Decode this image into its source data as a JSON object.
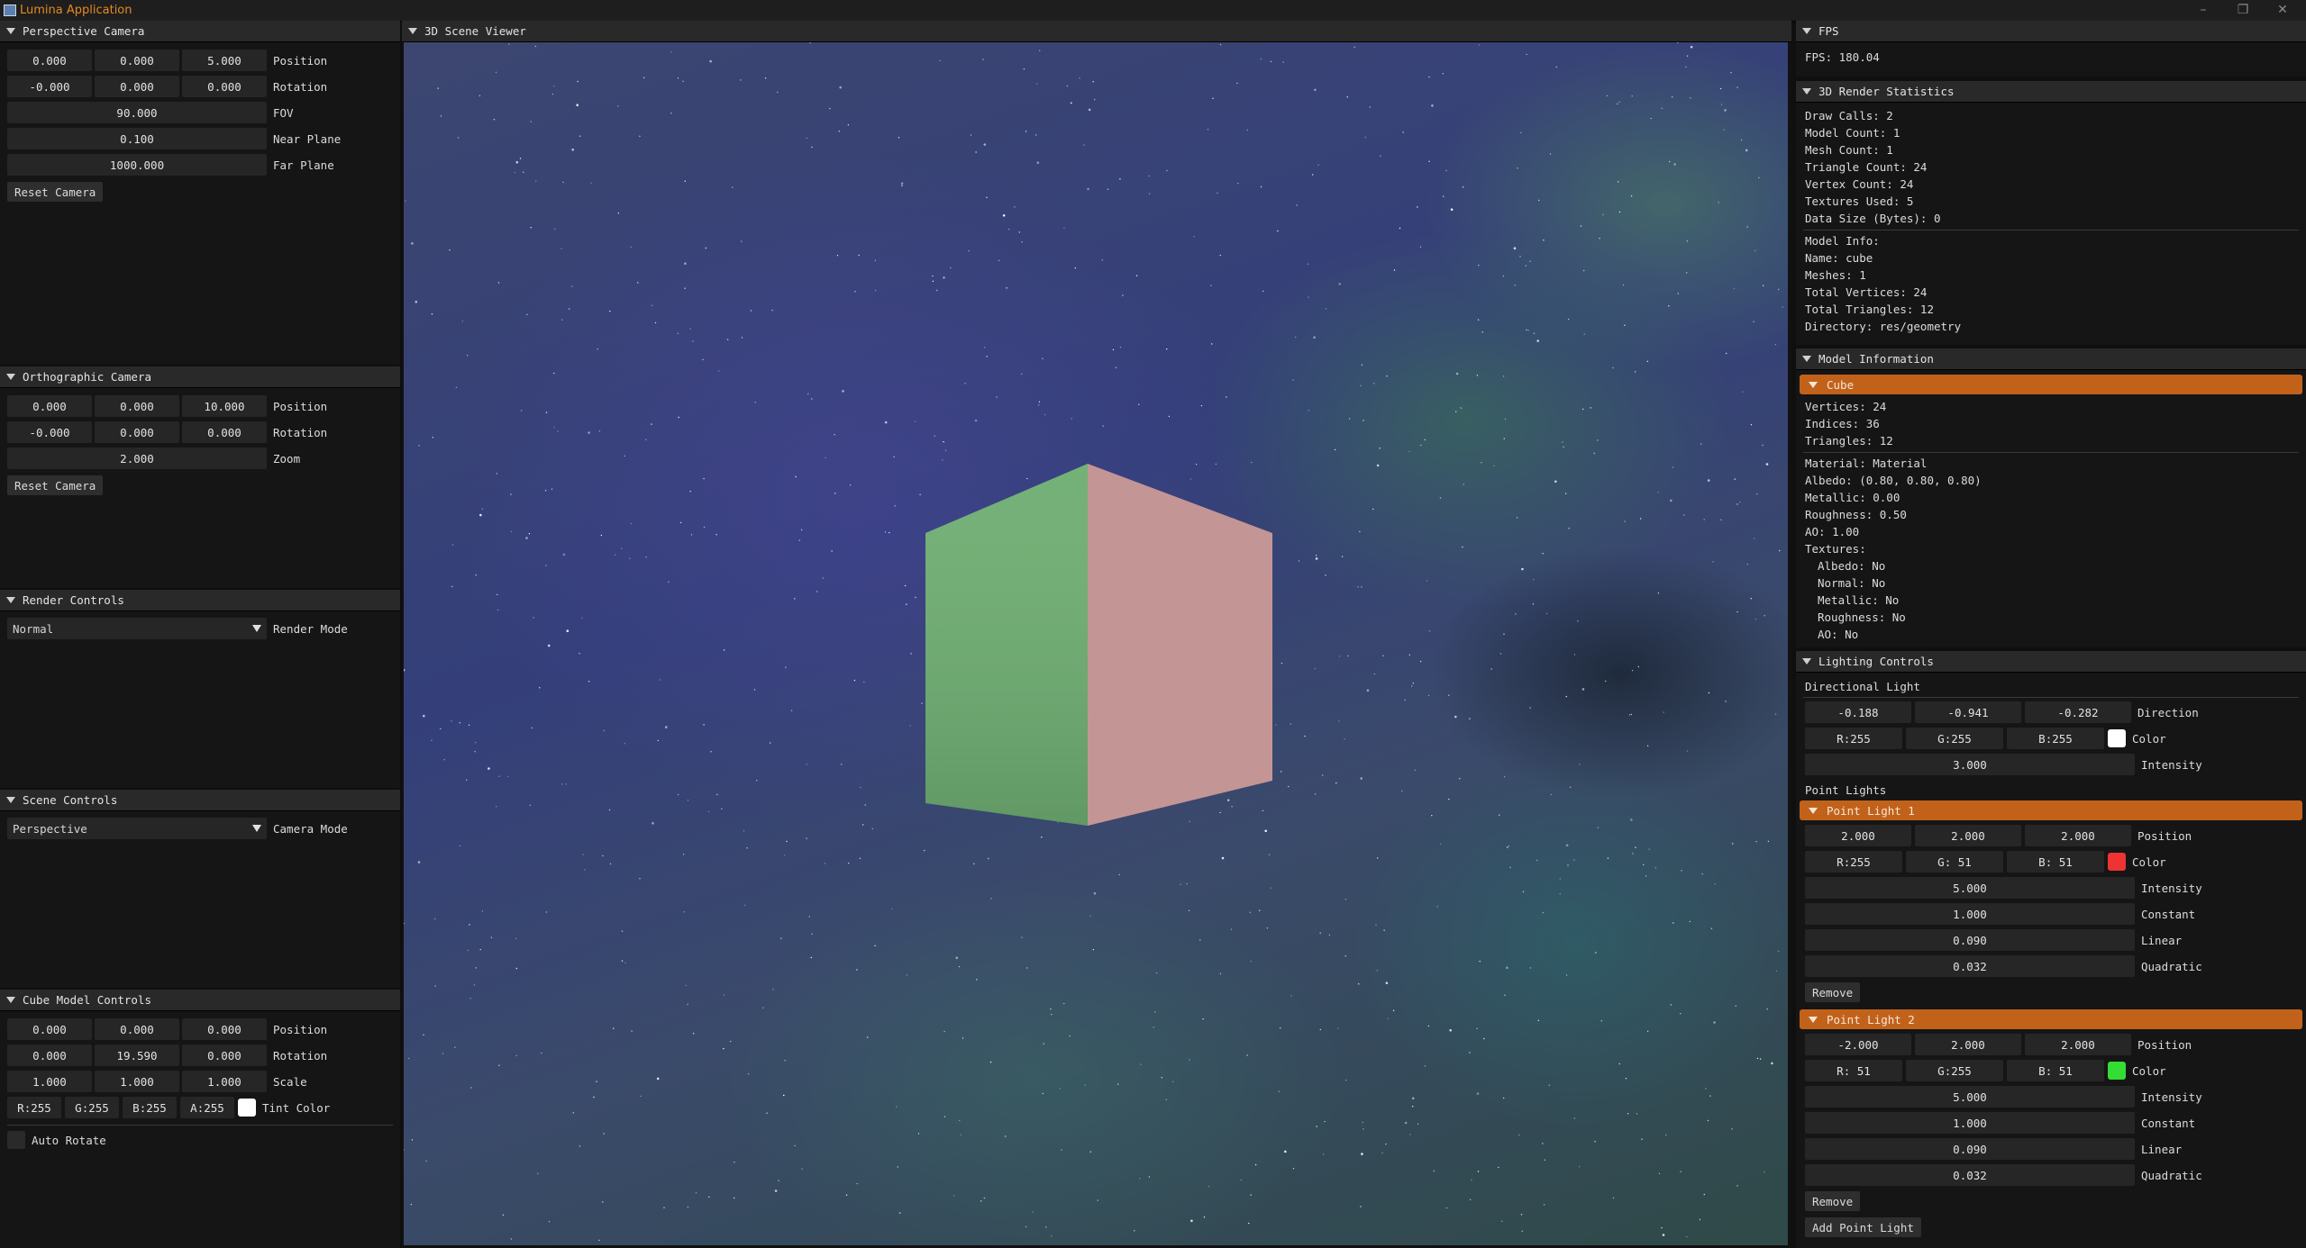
{
  "window": {
    "title": "Lumina Application"
  },
  "perspective_camera": {
    "title": "Perspective Camera",
    "position": [
      "0.000",
      "0.000",
      "5.000"
    ],
    "position_label": "Position",
    "rotation": [
      "-0.000",
      "0.000",
      "0.000"
    ],
    "rotation_label": "Rotation",
    "fov": "90.000",
    "fov_label": "FOV",
    "near": "0.100",
    "near_label": "Near Plane",
    "far": "1000.000",
    "far_label": "Far Plane",
    "reset_label": "Reset Camera"
  },
  "ortho_camera": {
    "title": "Orthographic Camera",
    "position": [
      "0.000",
      "0.000",
      "10.000"
    ],
    "position_label": "Position",
    "rotation": [
      "-0.000",
      "0.000",
      "0.000"
    ],
    "rotation_label": "Rotation",
    "zoom": "2.000",
    "zoom_label": "Zoom",
    "reset_label": "Reset Camera"
  },
  "render_controls": {
    "title": "Render Controls",
    "mode_value": "Normal",
    "mode_label": "Render Mode"
  },
  "scene_controls": {
    "title": "Scene Controls",
    "mode_value": "Perspective",
    "mode_label": "Camera Mode"
  },
  "cube_controls": {
    "title": "Cube Model Controls",
    "position": [
      "0.000",
      "0.000",
      "0.000"
    ],
    "position_label": "Position",
    "rotation": [
      "0.000",
      "19.590",
      "0.000"
    ],
    "rotation_label": "Rotation",
    "scale": [
      "1.000",
      "1.000",
      "1.000"
    ],
    "scale_label": "Scale",
    "tint": [
      "R:255",
      "G:255",
      "B:255",
      "A:255"
    ],
    "tint_label": "Tint Color",
    "tint_color": "#ffffff",
    "auto_rotate_label": "Auto Rotate"
  },
  "viewer": {
    "title": "3D Scene Viewer",
    "cube_left_color": "#6fae72",
    "cube_right_color": "#c49595"
  },
  "fps": {
    "title": "FPS",
    "text": "FPS: 180.04"
  },
  "stats": {
    "title": "3D Render Statistics",
    "lines": [
      "Draw Calls: 2",
      "Model Count: 1",
      "Mesh Count: 1",
      "Triangle Count: 24",
      "Vertex Count: 24",
      "Textures Used: 5",
      "Data Size (Bytes): 0"
    ],
    "model_lines": [
      "Model Info:",
      "Name: cube",
      "Meshes: 1",
      "Total Vertices: 24",
      "Total Triangles: 12",
      "Directory: res/geometry"
    ]
  },
  "model_info": {
    "title": "Model Information",
    "node": "Cube",
    "lines": [
      "Vertices: 24",
      "Indices: 36",
      "Triangles: 12"
    ],
    "material_lines": [
      "Material: Material",
      "Albedo: (0.80, 0.80, 0.80)",
      "Metallic: 0.00",
      "Roughness: 0.50",
      "AO: 1.00",
      "Textures:",
      "  Albedo: No",
      "  Normal: No",
      "  Metallic: No",
      "  Roughness: No",
      "  AO: No"
    ]
  },
  "lighting": {
    "title": "Lighting Controls",
    "directional_title": "Directional Light",
    "direction": [
      "-0.188",
      "-0.941",
      "-0.282"
    ],
    "direction_label": "Direction",
    "color": [
      "R:255",
      "G:255",
      "B:255"
    ],
    "color_label": "Color",
    "color_hex": "#ffffff",
    "intensity": "3.000",
    "intensity_label": "Intensity",
    "point_title": "Point Lights",
    "point_lights": [
      {
        "name": "Point Light 1",
        "position": [
          "2.000",
          "2.000",
          "2.000"
        ],
        "color": [
          "R:255",
          "G: 51",
          "B: 51"
        ],
        "color_hex": "#ee3333",
        "intensity": "5.000",
        "constant": "1.000",
        "linear": "0.090",
        "quadratic": "0.032"
      },
      {
        "name": "Point Light 2",
        "position": [
          "-2.000",
          "2.000",
          "2.000"
        ],
        "color": [
          "R: 51",
          "G:255",
          "B: 51"
        ],
        "color_hex": "#33dd33",
        "intensity": "5.000",
        "constant": "1.000",
        "linear": "0.090",
        "quadratic": "0.032"
      }
    ],
    "position_label": "Position",
    "color_label2": "Color",
    "intensity_label2": "Intensity",
    "constant_label": "Constant",
    "linear_label": "Linear",
    "quadratic_label": "Quadratic",
    "remove_label": "Remove",
    "add_label": "Add Point Light"
  },
  "colors": {
    "accent": "#c2621a",
    "panel_bg": "#151515",
    "header_bg": "#292929",
    "title_text": "#e58a1f"
  }
}
